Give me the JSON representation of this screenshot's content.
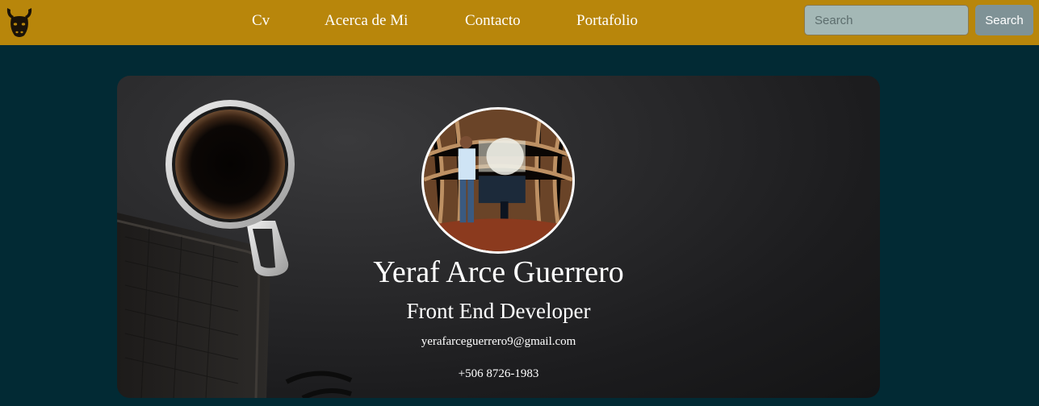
{
  "navbar": {
    "logo_icon": "bull-head-icon",
    "links": [
      "Cv",
      "Acerca de Mi",
      "Contacto",
      "Portafolio"
    ],
    "search_placeholder": "Search",
    "search_button": "Search",
    "background_color": "#b8860b"
  },
  "hero": {
    "name": "Yeraf Arce Guerrero",
    "title": "Front End Developer",
    "email": "yerafarceguerrero9@gmail.com",
    "phone": "+506 8726-1983"
  },
  "page": {
    "background_color": "#022a34"
  }
}
